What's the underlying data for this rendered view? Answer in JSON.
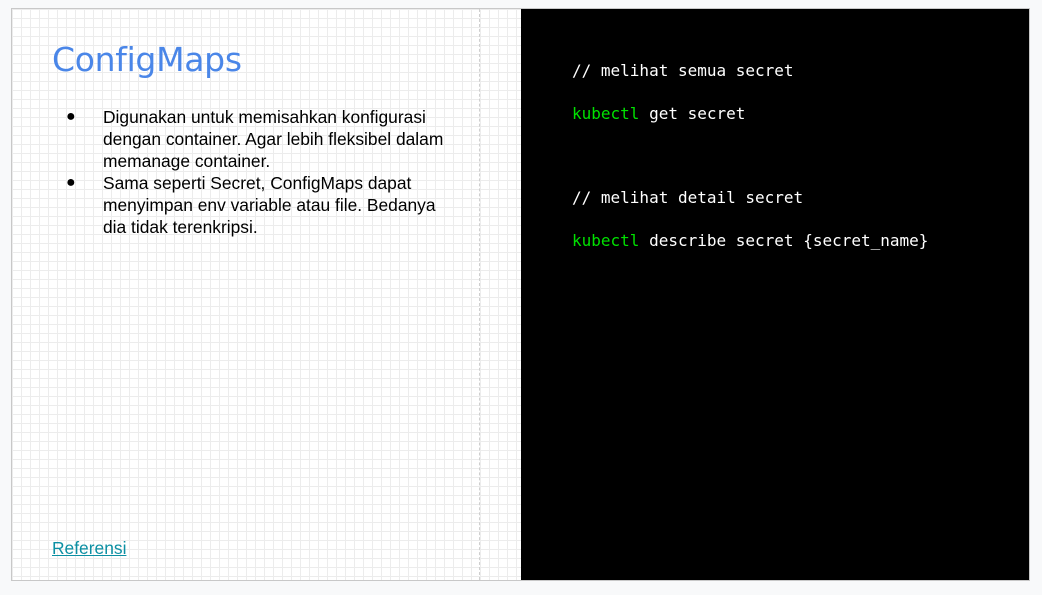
{
  "slide": {
    "title": "ConfigMaps",
    "bullets": [
      {
        "lines": [
          "Digunakan untuk memisahkan konfigurasi",
          "dengan container. Agar lebih fleksibel dalam",
          "memanage container."
        ]
      },
      {
        "lines": [
          "Sama seperti Secret, ConfigMaps dapat",
          "menyimpan env variable atau file. Bedanya",
          "dia tidak terenkripsi."
        ]
      }
    ],
    "bullet_glyph": "●",
    "link_text": "Referensi"
  },
  "code": {
    "comment_list": "// melihat semua secret",
    "cmd_list_keyword": "kubectl",
    "cmd_list_rest": " get secret",
    "comment_detail": "// melihat detail secret",
    "cmd_detail_keyword": "kubectl",
    "cmd_detail_rest": " describe secret {secret_name}"
  },
  "colors": {
    "title": "#4a86e8",
    "link": "#0b8fa3",
    "code_background": "#000000",
    "code_text": "#ffffff",
    "code_keyword": "#00e000"
  }
}
